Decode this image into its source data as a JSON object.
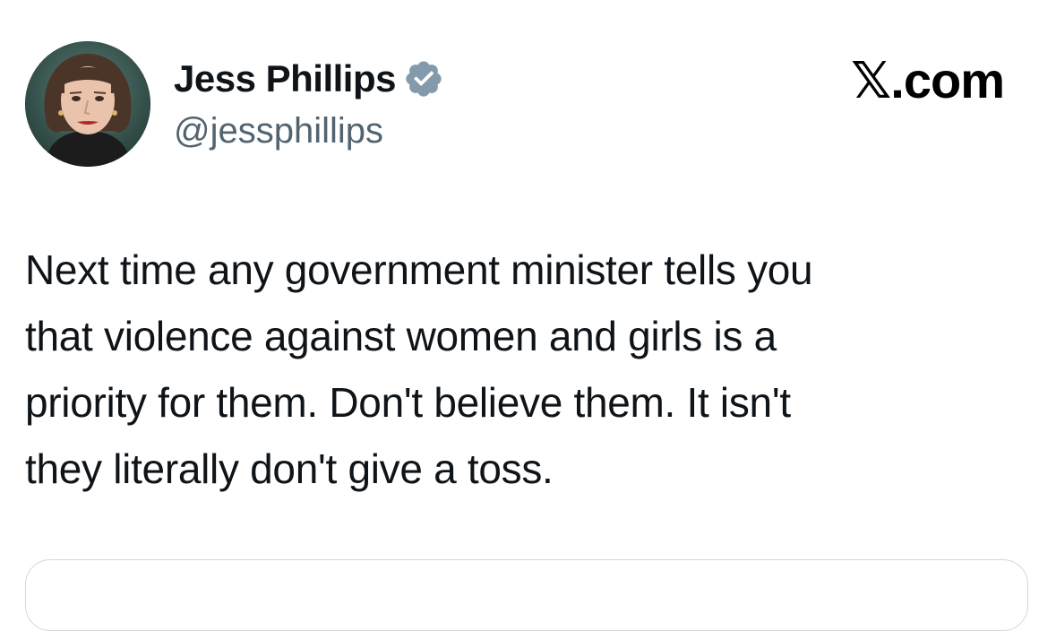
{
  "author": {
    "display_name": "Jess Phillips",
    "handle": "@jessphillips",
    "verified": true,
    "verified_badge_color": "#829aab",
    "avatar_icon": "profile-photo"
  },
  "brand": {
    "label": "𝕏.com"
  },
  "tweet": {
    "lines": [
      "Next time any government minister tells you",
      "that violence against women and girls is a",
      "priority for them. Don't believe them. It isn't",
      "they literally don't give a toss."
    ]
  },
  "colors": {
    "text": "#0f1419",
    "secondary": "#536471",
    "border": "#cfd9de"
  }
}
